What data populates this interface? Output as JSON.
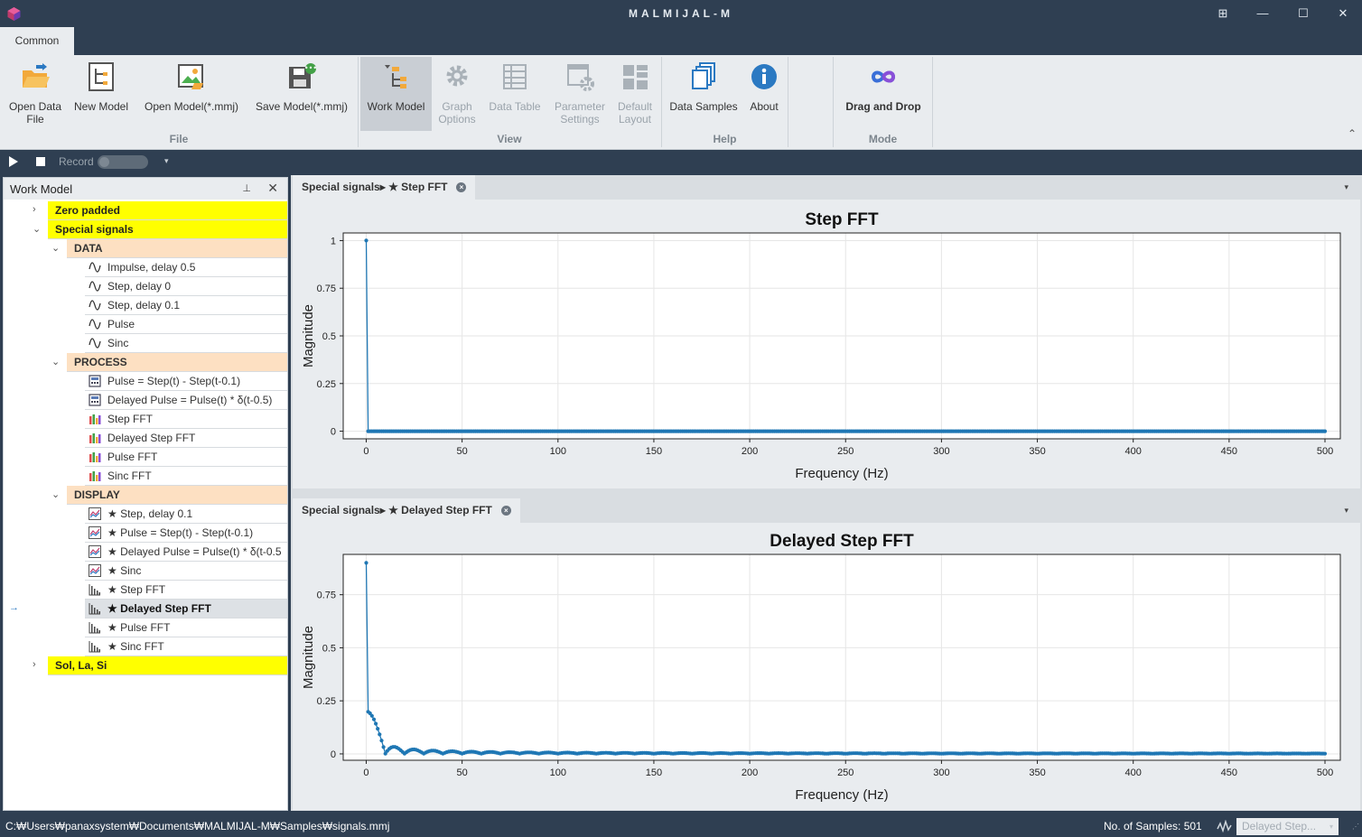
{
  "titlebar": {
    "title": "MALMIJAL-M",
    "restore_symbol": "⊞",
    "minimize_symbol": "—",
    "maximize_symbol": "☐",
    "close_symbol": "✕"
  },
  "ribbon": {
    "tab_label": "Common",
    "buttons": {
      "open_data_file": "Open Data\nFile",
      "new_model": "New Model",
      "open_model": "Open Model(*.mmj)",
      "save_model": "Save Model(*.mmj)",
      "work_model": "Work Model",
      "graph_options": "Graph\nOptions",
      "data_table": "Data Table",
      "parameter_settings": "Parameter\nSettings",
      "default_layout": "Default\nLayout",
      "data_samples": "Data Samples",
      "about": "About",
      "drag_and_drop": "Drag and Drop"
    },
    "groups": {
      "file": "File",
      "view": "View",
      "help": "Help",
      "mode": "Mode"
    },
    "collapse_symbol": "⌃"
  },
  "toolbar": {
    "record_label": "Record",
    "dropdown_symbol": "▾"
  },
  "work_model": {
    "title": "Work Model",
    "pin_symbol": "📌",
    "close_symbol": "✕",
    "rows": [
      {
        "kind": "cat",
        "text": "Zero padded",
        "expander": "›"
      },
      {
        "kind": "cat",
        "text": "Special signals",
        "expander": "⌄"
      },
      {
        "kind": "sec",
        "text": "DATA",
        "expander": "⌄"
      },
      {
        "kind": "item",
        "icon": "wave-icon",
        "text": "Impulse, delay 0.5"
      },
      {
        "kind": "item",
        "icon": "wave-icon",
        "text": "Step, delay 0"
      },
      {
        "kind": "item",
        "icon": "wave-icon",
        "text": "Step, delay 0.1"
      },
      {
        "kind": "item",
        "icon": "wave-icon",
        "text": "Pulse"
      },
      {
        "kind": "item",
        "icon": "wave-icon",
        "text": "Sinc"
      },
      {
        "kind": "sec",
        "text": "PROCESS",
        "expander": "⌄"
      },
      {
        "kind": "item",
        "icon": "calculator-icon",
        "text": "Pulse = Step(t) - Step(t-0.1)"
      },
      {
        "kind": "item",
        "icon": "calculator-icon",
        "text": "Delayed Pulse = Pulse(t) * δ(t-0.5)"
      },
      {
        "kind": "item",
        "icon": "fft-process-icon",
        "text": "Step FFT"
      },
      {
        "kind": "item",
        "icon": "fft-process-icon",
        "text": "Delayed Step FFT"
      },
      {
        "kind": "item",
        "icon": "fft-process-icon",
        "text": "Pulse FFT"
      },
      {
        "kind": "item",
        "icon": "fft-process-icon",
        "text": "Sinc FFT"
      },
      {
        "kind": "sec",
        "text": "DISPLAY",
        "expander": "⌄"
      },
      {
        "kind": "item",
        "icon": "line-chart-icon",
        "text": "★ Step, delay 0.1"
      },
      {
        "kind": "item",
        "icon": "line-chart-icon",
        "text": "★ Pulse = Step(t) - Step(t-0.1)"
      },
      {
        "kind": "item",
        "icon": "line-chart-icon",
        "text": "★ Delayed Pulse = Pulse(t) * δ(t-0.5"
      },
      {
        "kind": "item",
        "icon": "line-chart-icon",
        "text": "★ Sinc"
      },
      {
        "kind": "item",
        "icon": "bar-chart-icon",
        "text": "★ Step FFT"
      },
      {
        "kind": "item",
        "icon": "bar-chart-icon",
        "text": "★ Delayed Step FFT",
        "selected": true,
        "marker": "→"
      },
      {
        "kind": "item",
        "icon": "bar-chart-icon",
        "text": "★ Pulse FFT"
      },
      {
        "kind": "item",
        "icon": "bar-chart-icon",
        "text": "★ Sinc FFT"
      },
      {
        "kind": "cat",
        "text": "Sol, La, Si",
        "expander": "›"
      }
    ]
  },
  "documents": [
    {
      "tab": "Special signals▸ ★ Step FFT",
      "close_symbol": "×",
      "dropdown_symbol": "▾"
    },
    {
      "tab": "Special signals▸ ★ Delayed Step FFT",
      "close_symbol": "×",
      "dropdown_symbol": "▾"
    }
  ],
  "chart_data": [
    {
      "type": "line",
      "title": "Step FFT",
      "xlabel": "Frequency (Hz)",
      "ylabel": "Magnitude",
      "xlim": [
        -12,
        508
      ],
      "ylim": [
        -0.04,
        1.04
      ],
      "xticks": [
        0,
        50,
        100,
        150,
        200,
        250,
        300,
        350,
        400,
        450,
        500
      ],
      "yticks": [
        0,
        0.25,
        0.5,
        0.75,
        1
      ],
      "ytick_labels": [
        "0",
        "0.25",
        "0.5",
        "0.75",
        "1"
      ],
      "grid": true,
      "color": "#1f77b4",
      "description": "spike of 1 at 0 Hz, all other bins 0",
      "series": [
        {
          "x": [
            0,
            1,
            500
          ],
          "y": [
            1,
            0,
            0
          ]
        }
      ],
      "model": {
        "kind": "step",
        "dc": 1.0,
        "n": 501
      }
    },
    {
      "type": "line",
      "title": "Delayed Step FFT",
      "xlabel": "Frequency (Hz)",
      "ylabel": "Magnitude",
      "xlim": [
        -12,
        508
      ],
      "ylim": [
        -0.03,
        0.94
      ],
      "xticks": [
        0,
        50,
        100,
        150,
        200,
        250,
        300,
        350,
        400,
        450,
        500
      ],
      "yticks": [
        0,
        0.25,
        0.5,
        0.75
      ],
      "ytick_labels": [
        "0",
        "0.25",
        "0.5",
        "0.75"
      ],
      "grid": true,
      "color": "#1f77b4",
      "series": [
        {
          "x": [
            0,
            1,
            2,
            3,
            5,
            10,
            15,
            20,
            30,
            50,
            100,
            500
          ],
          "y": [
            0.9,
            0.197,
            0.19,
            0.17,
            0.12,
            0.0,
            0.04,
            0.0,
            0.022,
            0.012,
            0.006,
            0.001
          ]
        }
      ],
      "model": {
        "kind": "delayed",
        "dc": 0.9,
        "n": 501,
        "null_spacing": 10
      }
    }
  ],
  "statusbar": {
    "path": "C:₩Users₩panaxsystem₩Documents₩MALMIJAL-M₩Samples₩signals.mmj",
    "samples": "No. of Samples: 501",
    "combo_value": "Delayed Step...",
    "combo_arrow": "▾",
    "grip": "⋰"
  }
}
